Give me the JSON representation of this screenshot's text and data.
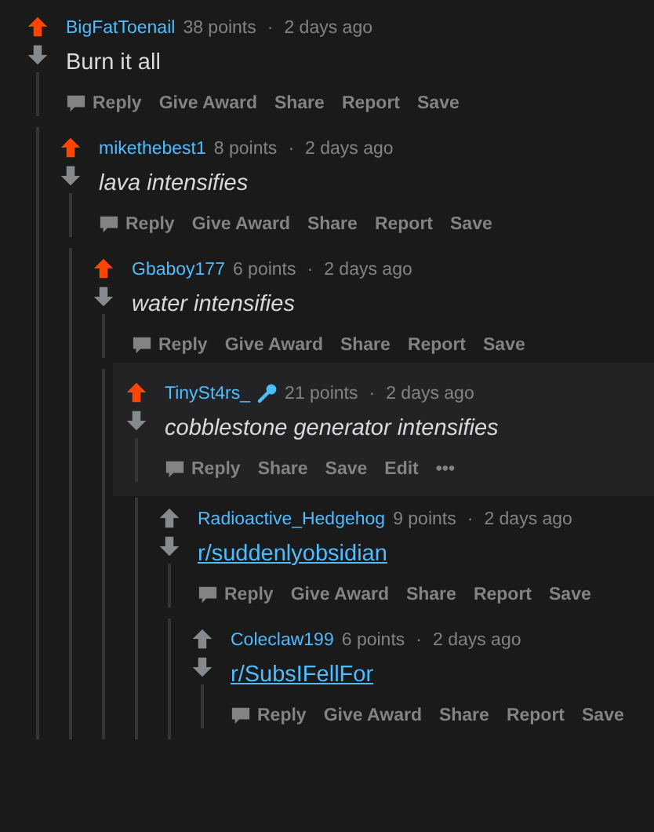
{
  "comments": [
    {
      "author": "BigFatToenail",
      "points": "38 points",
      "separator": "·",
      "time": "2 days ago",
      "body": "Burn it all",
      "italic": false,
      "link": false,
      "upvoted": true,
      "actions": [
        "Reply",
        "Give Award",
        "Share",
        "Report",
        "Save"
      ],
      "children": [
        {
          "author": "mikethebest1",
          "points": "8 points",
          "separator": "·",
          "time": "2 days ago",
          "body": "lava intensifies",
          "italic": true,
          "link": false,
          "upvoted": true,
          "actions": [
            "Reply",
            "Give Award",
            "Share",
            "Report",
            "Save"
          ],
          "children": [
            {
              "author": "Gbaboy177",
              "points": "6 points",
              "separator": "·",
              "time": "2 days ago",
              "body": "water intensifies",
              "italic": true,
              "link": false,
              "upvoted": true,
              "actions": [
                "Reply",
                "Give Award",
                "Share",
                "Report",
                "Save"
              ],
              "children": [
                {
                  "author": "TinySt4rs_",
                  "points": "21 points",
                  "separator": "·",
                  "time": "2 days ago",
                  "body": "cobblestone generator intensifies",
                  "italic": true,
                  "link": false,
                  "upvoted": true,
                  "highlighted": true,
                  "mic_badge": true,
                  "actions": [
                    "Reply",
                    "Share",
                    "Save",
                    "Edit",
                    "•••"
                  ],
                  "children": [
                    {
                      "author": "Radioactive_Hedgehog",
                      "points": "9 points",
                      "separator": "·",
                      "time": "2 days ago",
                      "body": "r/suddenlyobsidian",
                      "italic": false,
                      "link": true,
                      "upvoted": false,
                      "actions": [
                        "Reply",
                        "Give Award",
                        "Share",
                        "Report",
                        "Save"
                      ],
                      "children": [
                        {
                          "author": "Coleclaw199",
                          "points": "6 points",
                          "separator": "·",
                          "time": "2 days ago",
                          "body": "r/SubsIFellFor",
                          "italic": false,
                          "link": true,
                          "upvoted": false,
                          "actions": [
                            "Reply",
                            "Give Award",
                            "Share",
                            "Report",
                            "Save"
                          ]
                        }
                      ]
                    }
                  ]
                }
              ]
            }
          ]
        }
      ]
    }
  ]
}
